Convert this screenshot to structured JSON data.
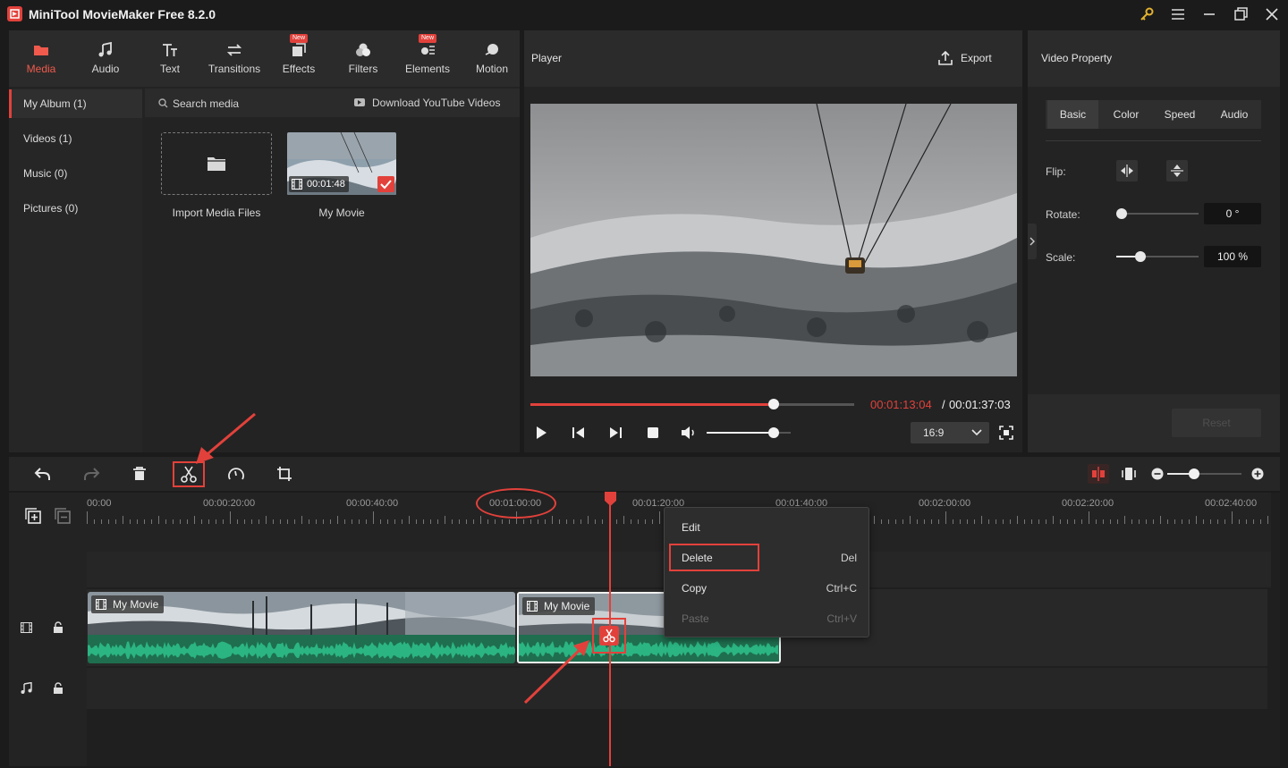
{
  "app": {
    "title": "MiniTool MovieMaker Free 8.2.0"
  },
  "toolbar": {
    "tabs": [
      {
        "label": "Media",
        "icon": "media-folder-icon",
        "active": true
      },
      {
        "label": "Audio",
        "icon": "music-note-icon"
      },
      {
        "label": "Text",
        "icon": "text-icon"
      },
      {
        "label": "Transitions",
        "icon": "transitions-icon"
      },
      {
        "label": "Effects",
        "icon": "effects-icon",
        "badge": "New"
      },
      {
        "label": "Filters",
        "icon": "filters-icon"
      },
      {
        "label": "Elements",
        "icon": "elements-icon",
        "badge": "New"
      },
      {
        "label": "Motion",
        "icon": "motion-icon"
      }
    ]
  },
  "album": {
    "items": [
      {
        "label": "My Album (1)",
        "active": true
      },
      {
        "label": "Videos (1)"
      },
      {
        "label": "Music (0)"
      },
      {
        "label": "Pictures (0)"
      }
    ]
  },
  "media": {
    "search_label": "Search media",
    "download_label": "Download YouTube Videos",
    "import_label": "Import Media Files",
    "clip_name": "My Movie",
    "clip_duration": "00:01:48"
  },
  "player": {
    "title": "Player",
    "export_label": "Export",
    "current_time": "00:01:13:04",
    "separator": "/",
    "total_time": "00:01:37:03",
    "progress": 0.75,
    "volume": 0.8,
    "aspect": "16:9"
  },
  "property": {
    "title": "Video Property",
    "tabs": [
      "Basic",
      "Color",
      "Speed",
      "Audio"
    ],
    "active_tab": "Basic",
    "flip_label": "Flip:",
    "rotate_label": "Rotate:",
    "rotate_value": "0 °",
    "scale_label": "Scale:",
    "scale_value": "100 %",
    "reset_label": "Reset"
  },
  "timeline": {
    "ticks": [
      "00:00",
      "00:00:20:00",
      "00:00:40:00",
      "00:01:00:00",
      "00:01:20:00",
      "00:01:40:00",
      "00:02:00:00",
      "00:02:20:00",
      "00:02:40:00"
    ],
    "clip1_label": "My Movie",
    "clip2_label": "My Movie"
  },
  "context_menu": {
    "items": [
      {
        "label": "Edit",
        "shortcut": ""
      },
      {
        "label": "Delete",
        "shortcut": "Del"
      },
      {
        "label": "Copy",
        "shortcut": "Ctrl+C"
      },
      {
        "label": "Paste",
        "shortcut": "Ctrl+V",
        "disabled": true
      }
    ]
  },
  "colors": {
    "accent": "#e2413b",
    "panel": "#232323",
    "audio_wave": "#2bb583",
    "audio_bg": "#1f6e4f"
  }
}
